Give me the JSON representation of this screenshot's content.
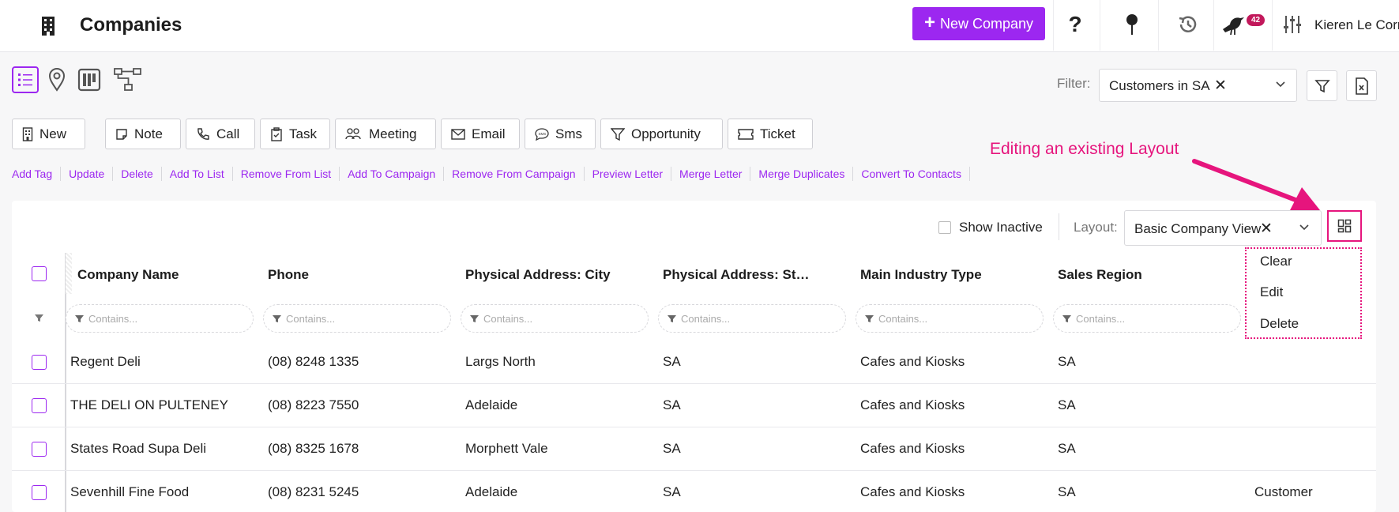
{
  "header": {
    "title": "Companies",
    "new_company_label": "New Company",
    "notification_count": "42",
    "user_name": "Kieren Le Corn"
  },
  "filter": {
    "label": "Filter:",
    "value": "Customers in SA"
  },
  "actions": [
    "New",
    "Note",
    "Call",
    "Task",
    "Meeting",
    "Email",
    "Sms",
    "Opportunity",
    "Ticket"
  ],
  "links": [
    "Add Tag",
    "Update",
    "Delete",
    "Add To List",
    "Remove From List",
    "Add To Campaign",
    "Remove From Campaign",
    "Preview Letter",
    "Merge Letter",
    "Merge Duplicates",
    "Convert To Contacts"
  ],
  "annotation": {
    "text": "Editing an existing Layout",
    "color": "#e6157d"
  },
  "grid": {
    "show_inactive_label": "Show Inactive",
    "layout_label": "Layout:",
    "layout_value": "Basic Company View",
    "layout_menu": [
      "Clear",
      "Edit",
      "Delete"
    ],
    "columns": [
      "Company Name",
      "Phone",
      "Physical Address: City",
      "Physical Address: St…",
      "Main Industry Type",
      "Sales Region"
    ],
    "filter_placeholder": "Contains...",
    "rows": [
      [
        "Regent Deli",
        "(08) 8248 1335",
        "Largs North",
        "SA",
        "Cafes and Kiosks",
        "SA",
        ""
      ],
      [
        "THE DELI ON PULTENEY",
        "(08) 8223 7550",
        "Adelaide",
        "SA",
        "Cafes and Kiosks",
        "SA",
        ""
      ],
      [
        "States Road Supa Deli",
        "(08) 8325 1678",
        "Morphett Vale",
        "SA",
        "Cafes and Kiosks",
        "SA",
        ""
      ],
      [
        "Sevenhill Fine Food",
        "(08) 8231 5245",
        "Adelaide",
        "SA",
        "Cafes and Kiosks",
        "SA",
        "Customer"
      ]
    ]
  },
  "colors": {
    "accent": "#9c27f0",
    "highlight": "#e6157d"
  }
}
